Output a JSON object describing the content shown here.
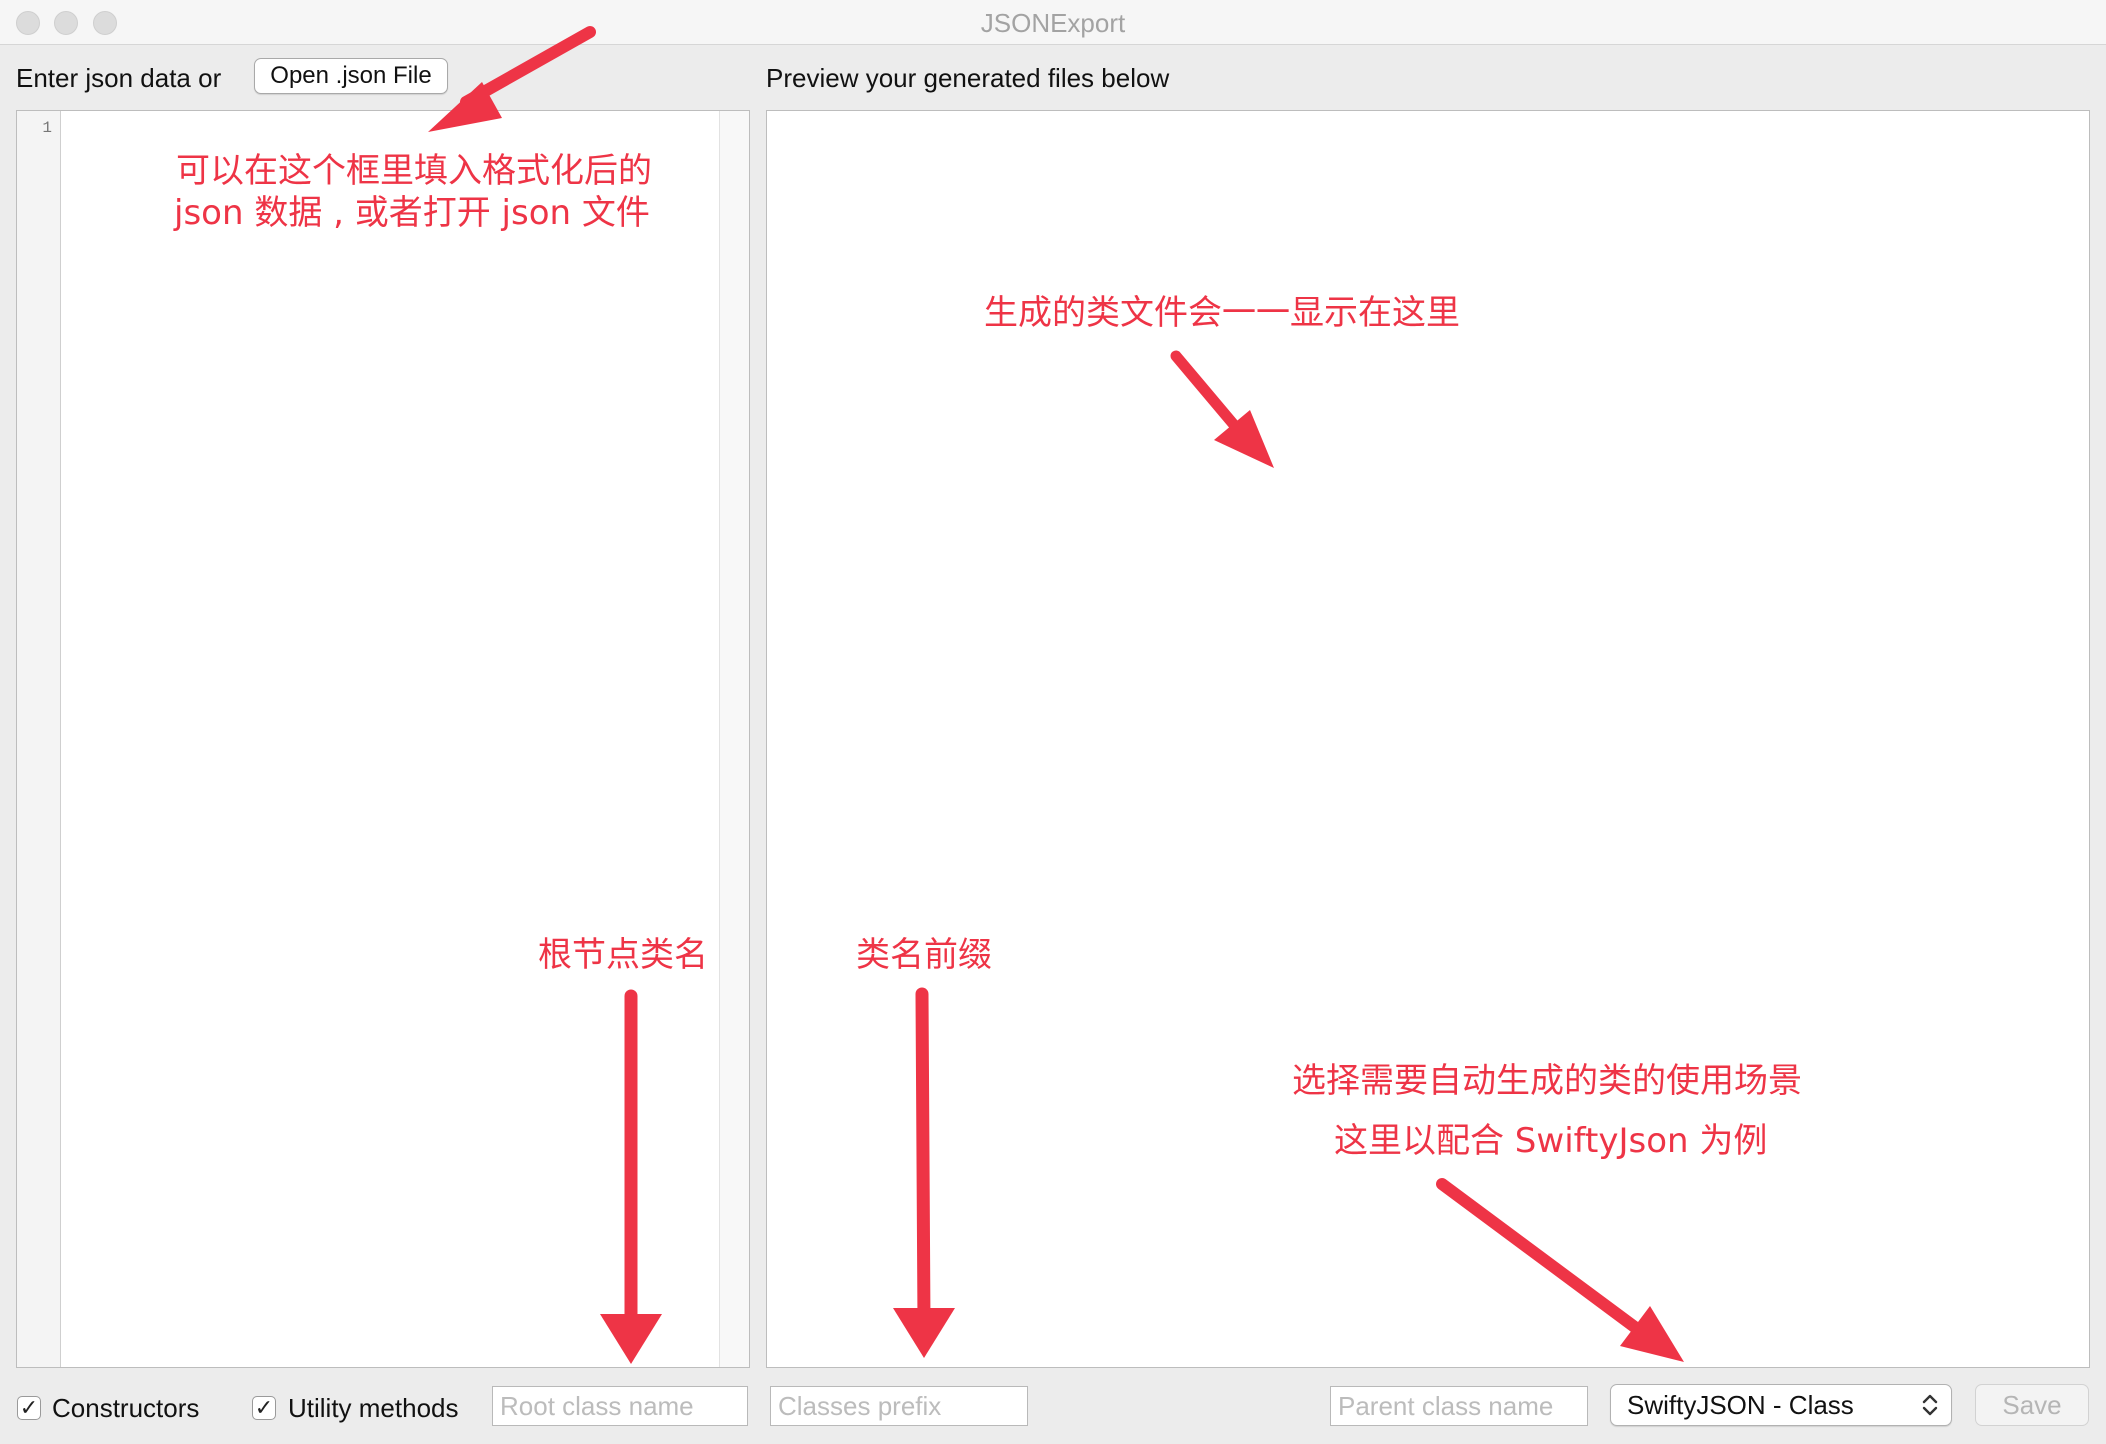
{
  "window": {
    "title": "JSONExport"
  },
  "left": {
    "enter_label": "Enter json data  or",
    "open_button": "Open .json File",
    "line_number": "1"
  },
  "right": {
    "preview_label": "Preview your generated files below"
  },
  "bottom": {
    "constructors_label": "Constructors",
    "constructors_checked": true,
    "utility_label": "Utility methods",
    "utility_checked": true,
    "root_class_placeholder": "Root class name",
    "classes_prefix_placeholder": "Classes prefix",
    "parent_class_placeholder": "Parent class name",
    "language_selected": "SwiftyJSON - Class",
    "save_label": "Save",
    "check_glyph": "✓"
  },
  "annotations": {
    "json_input_line1": "可以在这个框里填入格式化后的",
    "json_input_line2": "json 数据 , 或者打开 json 文件",
    "preview_note": "生成的类文件会一一显示在这里",
    "root_class_note": "根节点类名",
    "prefix_note": "类名前缀",
    "scenario_line1": "选择需要自动生成的类的使用场景",
    "scenario_line2": "这里以配合 SwiftyJson 为例"
  },
  "colors": {
    "annotation_red": "#ee3446",
    "window_bg": "#ececec"
  }
}
